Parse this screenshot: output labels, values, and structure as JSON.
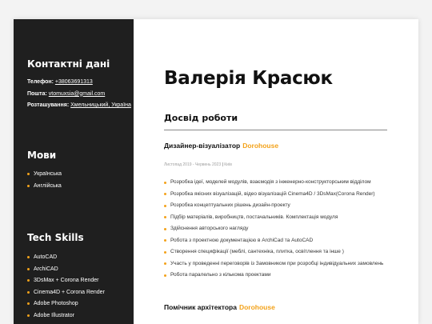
{
  "sidebar": {
    "contacts": {
      "heading": "Контактні дані",
      "phone_label": "Телефон:",
      "phone": "+38063691313",
      "email_label": "Пошта:",
      "email": "vtomuxsia@gmail.com",
      "location_label": "Розташування:",
      "location": "Хмельницький, Україна"
    },
    "languages": {
      "heading": "Мови",
      "items": [
        "Українська",
        "Англійська"
      ]
    },
    "tech_skills": {
      "heading": "Tech Skills",
      "items": [
        "AutoCAD",
        "ArchiCAD",
        "3DsMax + Corona Render",
        "Cinema4D + Corona Render",
        "Adobe Photoshop",
        "Adobe Illustrator"
      ]
    }
  },
  "main": {
    "name": "Валерія Красюк",
    "experience_heading": "Досвід роботи",
    "jobs": [
      {
        "title": "Дизайнер-візуалізатор",
        "company": "Dorohouse",
        "period": "Листопад 2019 - Червень 2023",
        "separator": "|",
        "location": "Київ",
        "duties": [
          "Розробка ідеї, моделей модулів, взаємодія з інженерно-конструкторським відділом",
          "Розробка якісних візуалізацій, відео візуалізацій Cinema4D / 3DsMax(Corona Render)",
          "Розробка концептуальних рішень дизайн-проекту",
          "Підбір матеріалів, виробництв, постачальників. Комплектація модуля",
          "Здійснення авторського нагляду",
          "Робота з проектною документацією в ArchiCad та AutoCAD",
          "Створення специфікації (меблі, сантехніка, плитка, освітлення та інше )",
          "Участь у проведенні переговорів із Замовником при розробці індивідуальних замовлень",
          "Робота паралельно з кількома проектами"
        ]
      },
      {
        "title": "Помічник архітектора",
        "company": "Dorohouse"
      }
    ]
  },
  "colors": {
    "accent": "#f3a21a",
    "sidebar_bg": "#1f1f1f",
    "page_bg": "#f3f3f3"
  }
}
